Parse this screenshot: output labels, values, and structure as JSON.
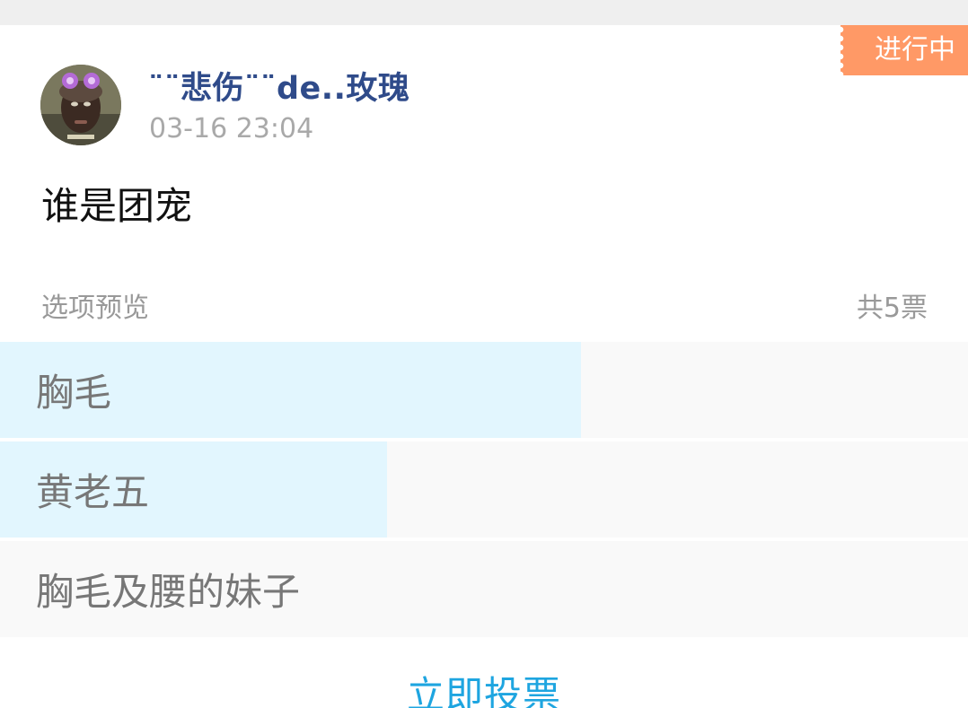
{
  "post": {
    "status": "进行中",
    "username": "¨¨悲伤¨¨de..玫瑰",
    "timestamp": "03-16 23:04",
    "question": "谁是团宠"
  },
  "poll": {
    "options_label": "选项预览",
    "total_votes": "共5票",
    "options": [
      {
        "label": "胸毛",
        "vote_fraction": 0.6
      },
      {
        "label": "黄老五",
        "vote_fraction": 0.4
      },
      {
        "label": "胸毛及腰的妹子",
        "vote_fraction": 0
      }
    ],
    "vote_button": "立即投票"
  },
  "colors": {
    "badge": "#ff9966",
    "username": "#2f4b8a",
    "bar_fill": "#e2f6fe",
    "bar_track": "#f9f9f9",
    "vote_button": "#1ea5e0"
  }
}
